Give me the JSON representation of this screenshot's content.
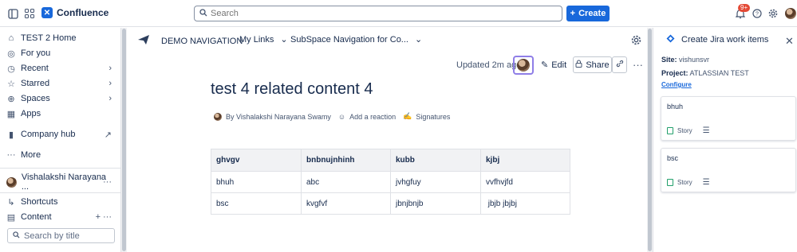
{
  "topbar": {
    "app_name": "Confluence",
    "search_placeholder": "Search",
    "create_label": "Create",
    "notification_count": "9+"
  },
  "sidebar": {
    "space_home": "TEST 2 Home",
    "items": [
      {
        "label": "For you"
      },
      {
        "label": "Recent"
      },
      {
        "label": "Starred"
      },
      {
        "label": "Spaces"
      },
      {
        "label": "Apps"
      },
      {
        "label": "Company hub"
      },
      {
        "label": "More"
      }
    ],
    "user_name": "Vishalakshi Narayana ...",
    "shortcuts": "Shortcuts",
    "content": "Content",
    "search_placeholder": "Search by title"
  },
  "space_nav": {
    "demo": "DEMO NAVIGATION",
    "my_links": "My Links",
    "subspace": "SubSpace Navigation for Co..."
  },
  "page": {
    "updated": "Updated 2m ago",
    "edit_label": "Edit",
    "share_label": "Share",
    "title": "test 4 related content 4",
    "byline_author": "By Vishalakshi Narayana Swamy",
    "add_reaction": "Add a reaction",
    "signatures": "Signatures",
    "table": {
      "headers": [
        "ghvgv",
        "bnbnujnhinh",
        "kubb",
        "kjbj"
      ],
      "rows": [
        [
          "bhuh",
          "abc",
          "jvhgfuy",
          "vvfhvjfd"
        ],
        [
          "bsc",
          "kvgfvf",
          "jbnjbnjb",
          " jbjb jbjbj"
        ]
      ]
    }
  },
  "jira_panel": {
    "title": "Create Jira work items",
    "site_label": "Site:",
    "site_value": "vishunsvr",
    "project_label": "Project:",
    "project_value": "ATLASSIAN TEST",
    "configure": "Configure",
    "items": [
      {
        "title": "bhuh",
        "type": "Story"
      },
      {
        "title": "bsc",
        "type": "Story"
      }
    ]
  }
}
